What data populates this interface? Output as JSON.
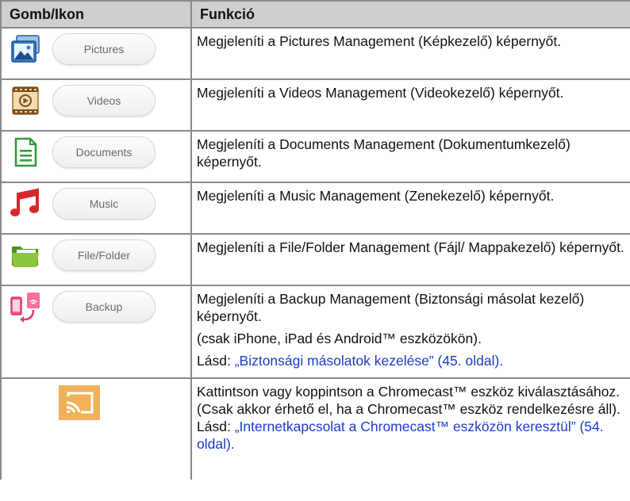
{
  "headers": {
    "col1": "Gomb/Ikon",
    "col2": "Funkció"
  },
  "rows": [
    {
      "button": "Pictures",
      "icon": "pictures-icon",
      "text": "Megjeleníti a Pictures Management (Képkezelő) képernyőt."
    },
    {
      "button": "Videos",
      "icon": "videos-icon",
      "text": "Megjeleníti a Videos Management (Videokezelő) képernyőt."
    },
    {
      "button": "Documents",
      "icon": "documents-icon",
      "text": "Megjeleníti a Documents Management (Dokumentumkezelő) képernyőt."
    },
    {
      "button": "Music",
      "icon": "music-icon",
      "text": "Megjeleníti a Music Management (Zenekezelő) képernyőt."
    },
    {
      "button": "File/Folder",
      "icon": "folder-icon",
      "text": "Megjeleníti a File/Folder Management (Fájl/ Mappakezelő) képernyőt."
    },
    {
      "button": "Backup",
      "icon": "backup-icon",
      "text": "Megjeleníti a Backup Management (Biztonsági másolat kezelő) képernyőt.",
      "note": "(csak iPhone, iPad és Android™ eszközökön).",
      "see": "Lásd: ",
      "link": "„Biztonsági másolatok kezelése” (45. oldal)."
    },
    {
      "icon": "chromecast-icon",
      "text": "Kattintson vagy koppintson a Chromecast™ eszköz kiválasztásához. (Csak akkor érhető el, ha a Chromecast™ eszköz rendelkezésre áll).",
      "see": "Lásd: ",
      "link": "„Internetkapcsolat a Chromecast™ eszközön keresztül” (54. oldal)."
    }
  ],
  "colors": {
    "header_bg": "#cfcfcf",
    "border": "#8a8a8a",
    "link": "#1a3cc8",
    "cast_bg": "#f0b15a"
  }
}
